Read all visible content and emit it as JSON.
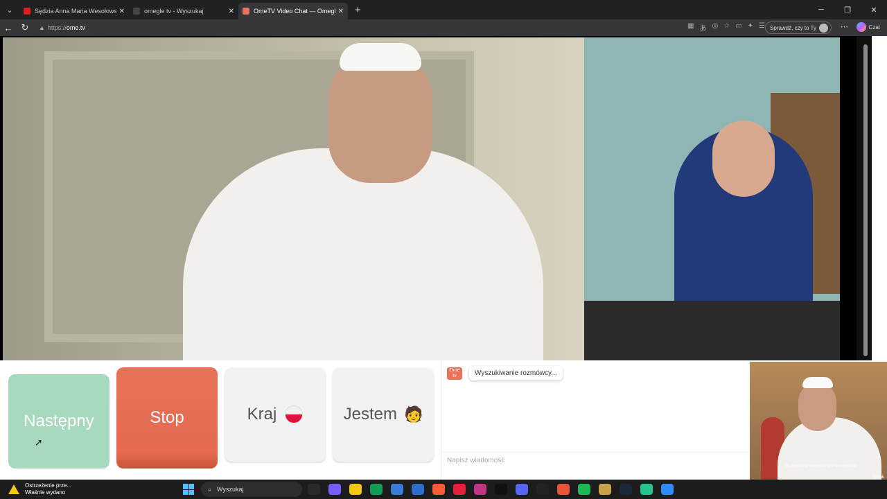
{
  "browser": {
    "tabs": [
      {
        "title": "Sędzia Anna Maria Wesołowska o",
        "color": "#e02020"
      },
      {
        "title": "omegle tv - Wyszukaj",
        "color": "#444444"
      },
      {
        "title": "OmeTV Video Chat — Omegle",
        "color": "#e8735a"
      }
    ],
    "url_protocol": "https://",
    "url_host": "ome.tv",
    "profile_label": "Sprawdź, czy to Ty",
    "copilot_label": "Czat"
  },
  "controls": {
    "next_label": "Następny",
    "stop_label": "Stop",
    "country_label": "Kraj",
    "me_label": "Jestem",
    "me_emoji": "🧑"
  },
  "chat": {
    "logo_text": "Ome tv",
    "status_message": "Wyszukiwanie rozmówcy...",
    "input_placeholder": "Napisz wiadomość"
  },
  "overlay": {
    "caption": "It's incredibly energetic and enthusiastic",
    "tiktok_label": "TikTok"
  },
  "taskbar": {
    "notification_title": "Ostrzeżenie prze...",
    "notification_sub": "Właśnie wydano",
    "search_label": "Wyszukaj",
    "app_colors": [
      "#2a2a2a",
      "#7a5cff",
      "#f2c811",
      "#0f9d58",
      "#3a7bd5",
      "#2d6bcf",
      "#ff5a36",
      "#e2223d",
      "#c13584",
      "#111111",
      "#5865f2",
      "#222222",
      "#e8553a",
      "#1db954",
      "#c8a24a",
      "#1b2838",
      "#24c48f",
      "#2f8cff"
    ]
  },
  "colors": {
    "next_button": "#a6d9be",
    "stop_button": "#e57358",
    "neutral_button": "#f2f2f2"
  }
}
